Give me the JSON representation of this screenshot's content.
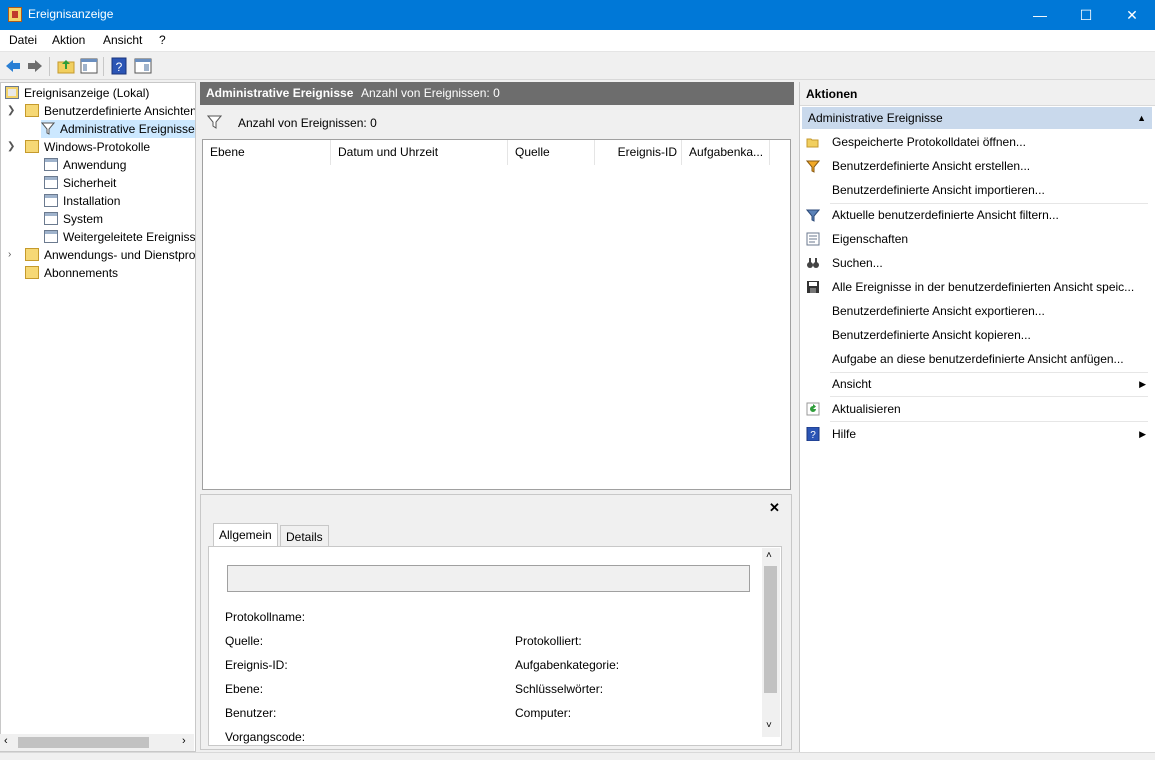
{
  "window": {
    "title": "Ereignisanzeige",
    "minimize": "—",
    "maximize": "☐",
    "close": "✕"
  },
  "menubar": {
    "items": [
      "Datei",
      "Aktion",
      "Ansicht",
      "?"
    ]
  },
  "tree": {
    "items": [
      {
        "label": "Ereignisanzeige (Lokal)",
        "icon": "root-icon"
      },
      {
        "label": "Benutzerdefinierte Ansichten",
        "icon": "folder-icon",
        "expanded": true
      },
      {
        "label": "Administrative Ereignisse",
        "icon": "filter-icon",
        "selected": true
      },
      {
        "label": "Windows-Protokolle",
        "icon": "folder-icon",
        "expanded": true
      },
      {
        "label": "Anwendung",
        "icon": "log-icon"
      },
      {
        "label": "Sicherheit",
        "icon": "log-icon"
      },
      {
        "label": "Installation",
        "icon": "log-icon"
      },
      {
        "label": "System",
        "icon": "log-icon"
      },
      {
        "label": "Weitergeleitete Ereignisse",
        "icon": "log-icon"
      },
      {
        "label": "Anwendungs- und Dienstprotokolle",
        "icon": "folder-icon",
        "expanded": false
      },
      {
        "label": "Abonnements",
        "icon": "subscription-icon"
      }
    ]
  },
  "center": {
    "header_title": "Administrative Ereignisse",
    "header_count": "Anzahl von Ereignissen: 0",
    "filter_text": "Anzahl von Ereignissen: 0",
    "columns": [
      "Ebene",
      "Datum und Uhrzeit",
      "Quelle",
      "Ereignis-ID",
      "Aufgabenka..."
    ]
  },
  "detail": {
    "close": "✕",
    "tabs": [
      "Allgemein",
      "Details"
    ],
    "fields": {
      "protokollname": "Protokollname:",
      "quelle": "Quelle:",
      "protokolliert": "Protokolliert:",
      "ereignis_id": "Ereignis-ID:",
      "aufgabenkategorie": "Aufgabenkategorie:",
      "ebene": "Ebene:",
      "schluesselwoerter": "Schlüsselwörter:",
      "benutzer": "Benutzer:",
      "computer": "Computer:",
      "vorgangscode": "Vorgangscode:"
    }
  },
  "actions": {
    "header": "Aktionen",
    "section": "Administrative Ereignisse",
    "items": [
      {
        "label": "Gespeicherte Protokolldatei öffnen...",
        "icon": "open-folder-icon"
      },
      {
        "label": "Benutzerdefinierte Ansicht erstellen...",
        "icon": "create-filter-icon"
      },
      {
        "label": "Benutzerdefinierte Ansicht importieren...",
        "icon": ""
      },
      {
        "label": "Aktuelle benutzerdefinierte Ansicht filtern...",
        "icon": "filter-icon"
      },
      {
        "label": "Eigenschaften",
        "icon": "properties-icon"
      },
      {
        "label": "Suchen...",
        "icon": "binoculars-icon"
      },
      {
        "label": "Alle Ereignisse in der benutzerdefinierten Ansicht speic...",
        "icon": "save-icon"
      },
      {
        "label": "Benutzerdefinierte Ansicht exportieren...",
        "icon": ""
      },
      {
        "label": "Benutzerdefinierte Ansicht kopieren...",
        "icon": ""
      },
      {
        "label": "Aufgabe an diese benutzerdefinierte Ansicht anfügen...",
        "icon": ""
      },
      {
        "label": "Ansicht",
        "icon": "",
        "submenu": true
      },
      {
        "label": "Aktualisieren",
        "icon": "refresh-icon"
      },
      {
        "label": "Hilfe",
        "icon": "help-icon",
        "submenu": true
      }
    ]
  }
}
